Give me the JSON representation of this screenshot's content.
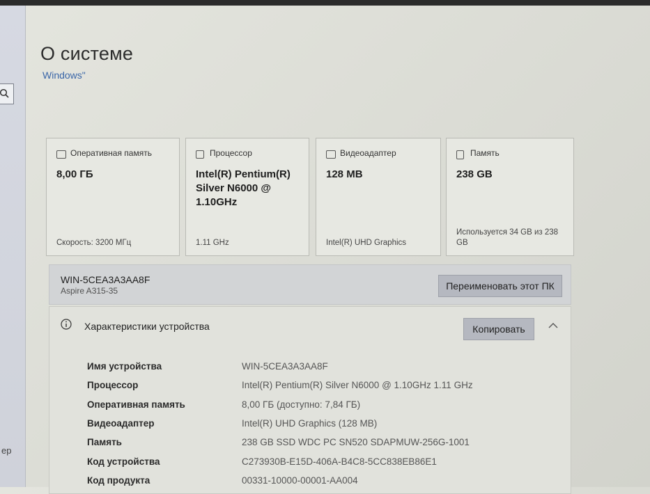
{
  "page": {
    "title": "О системе",
    "subtitle": "Windows\""
  },
  "sidebar": {
    "truncated_text": "ер"
  },
  "cards": [
    {
      "icon": "memory-icon",
      "title": "Оперативная память",
      "value": "8,00 ГБ",
      "footer": "Скорость: 3200 МГц"
    },
    {
      "icon": "processor-icon",
      "title": "Процессор",
      "value": "Intel(R) Pentium(R) Silver N6000 @ 1.10GHz",
      "footer": "1.11 GHz"
    },
    {
      "icon": "video-adapter-icon",
      "title": "Видеоадаптер",
      "value": "128 MB",
      "footer": "Intel(R) UHD Graphics"
    },
    {
      "icon": "storage-icon",
      "title": "Память",
      "value": "238 GB",
      "footer": "Используется 34 GB из 238 GB"
    }
  ],
  "device": {
    "name": "WIN-5CEA3A3AA8F",
    "model": "Aspire A315-35",
    "rename_label": "Переименовать этот ПК"
  },
  "specs": {
    "title": "Характеристики устройства",
    "copy_label": "Копировать",
    "rows": [
      {
        "key": "Имя устройства",
        "value": "WIN-5CEA3A3AA8F"
      },
      {
        "key": "Процессор",
        "value": "Intel(R) Pentium(R) Silver N6000 @ 1.10GHz   1.11 GHz"
      },
      {
        "key": "Оперативная память",
        "value": "8,00 ГБ (доступно: 7,84 ГБ)"
      },
      {
        "key": "Видеоадаптер",
        "value": "Intel(R) UHD Graphics (128 MB)"
      },
      {
        "key": "Память",
        "value": "238 GB SSD WDC PC SN520 SDAPMUW-256G-1001"
      },
      {
        "key": "Код устройства",
        "value": "C273930B-E15D-406A-B4C8-5CC838EB86E1"
      },
      {
        "key": "Код продукта",
        "value": "00331-10000-00001-AA004"
      }
    ]
  },
  "colors": {
    "accent_link": "#3a66a8",
    "button_bg": "#b5b8c0"
  }
}
